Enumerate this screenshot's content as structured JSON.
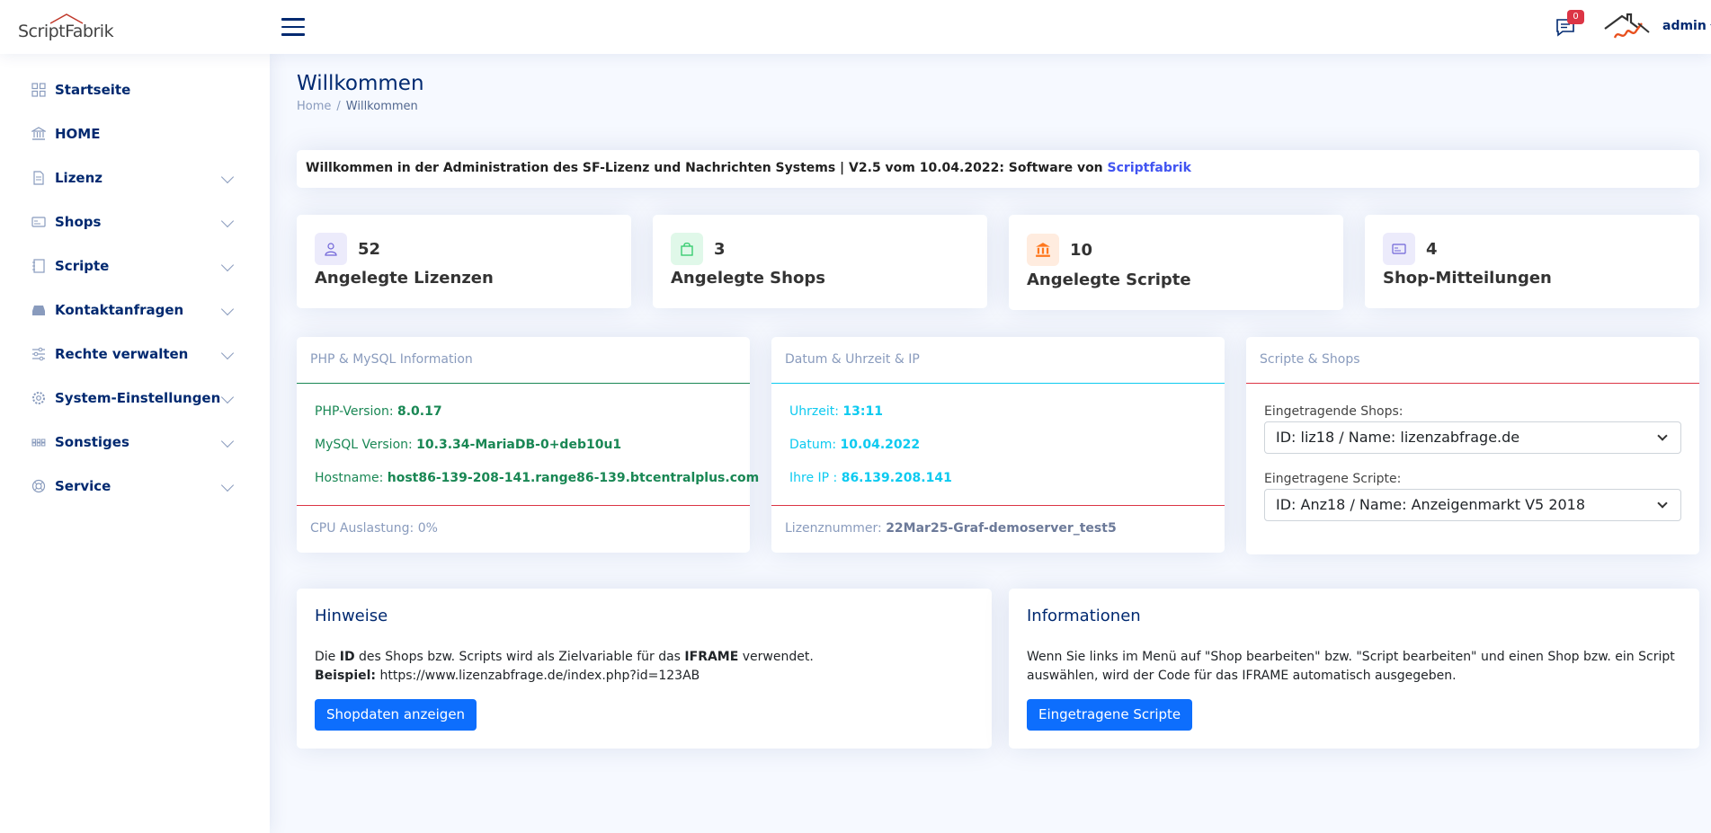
{
  "header": {
    "logo_text": "ScriptFabrik",
    "messages_count": "0",
    "user_name": "admin"
  },
  "sidebar": {
    "items": [
      {
        "label": "Startseite",
        "icon": "grid-icon",
        "has_children": false
      },
      {
        "label": "HOME",
        "icon": "bank-icon",
        "has_children": false
      },
      {
        "label": "Lizenz",
        "icon": "file-icon",
        "has_children": true
      },
      {
        "label": "Shops",
        "icon": "card-icon",
        "has_children": true
      },
      {
        "label": "Scripte",
        "icon": "journal-icon",
        "has_children": true
      },
      {
        "label": "Kontaktanfragen",
        "icon": "inbox-icon",
        "has_children": true
      },
      {
        "label": "Rechte verwalten",
        "icon": "sliders-icon",
        "has_children": true
      },
      {
        "label": "System-Einstellungen",
        "icon": "gear-icon",
        "has_children": true
      },
      {
        "label": "Sonstiges",
        "icon": "dots-icon",
        "has_children": true
      },
      {
        "label": "Service",
        "icon": "lifebuoy-icon",
        "has_children": true
      }
    ]
  },
  "page": {
    "title": "Willkommen",
    "breadcrumb_home": "Home",
    "breadcrumb_sep": "/",
    "breadcrumb_current": "Willkommen"
  },
  "welcome": {
    "text": "Willkommen in der Administration des SF-Lizenz und Nachrichten Systems | V2.5 vom 10.04.2022: Software von ",
    "link": "Scriptfabrik"
  },
  "stats": [
    {
      "count": "52",
      "label": "Angelegte Lizenzen",
      "icon": "person-icon",
      "bg": "#ecebfb",
      "fg": "#6f64d8"
    },
    {
      "count": "3",
      "label": "Angelegte Shops",
      "icon": "bag-icon",
      "bg": "#e0f8e9",
      "fg": "#2eca6a"
    },
    {
      "count": "10",
      "label": "Angelegte Scripte",
      "icon": "bank-icon",
      "bg": "#ffecdf",
      "fg": "#ff771d"
    },
    {
      "count": "4",
      "label": "Shop-Mitteilungen",
      "icon": "card-icon",
      "bg": "#ecebfb",
      "fg": "#6f64d8"
    }
  ],
  "php_info": {
    "title": "PHP & MySQL Information",
    "php_label": "PHP-Version: ",
    "php_value": "8.0.17",
    "mysql_label": "MySQL Version: ",
    "mysql_value": "10.3.34-MariaDB-0+deb10u1",
    "host_label": "Hostname: ",
    "host_value": "host86-139-208-141.range86-139.btcentralplus.com",
    "cpu": "CPU Auslastung: 0%",
    "accent": "#198754"
  },
  "date_info": {
    "title": "Datum & Uhrzeit & IP",
    "time_label": "Uhrzeit: ",
    "time_value": "13:11",
    "date_label": "Datum: ",
    "date_value": "10.04.2022",
    "ip_label": "Ihre IP : ",
    "ip_value": "86.139.208.141",
    "license_label": "Lizenznummer: ",
    "license_value": "22Mar25-Graf-demoserver_test5",
    "accent": "#0dcaf0"
  },
  "scripts_shops": {
    "title": "Scripte & Shops",
    "shops_label": "Eingetragende Shops:",
    "shops_selected": "ID: liz18  /  Name: lizenzabfrage.de",
    "scripts_label": "Eingetragene Scripte:",
    "scripts_selected": "ID: Anz18 /   Name: Anzeigenmarkt V5 2018"
  },
  "hinweise": {
    "title": "Hinweise",
    "line1_a": "Die ",
    "line1_b": "ID",
    "line1_c": " des Shops bzw. Scripts wird als Zielvariable für das ",
    "line1_d": "IFRAME",
    "line1_e": " verwendet.",
    "line2_a": "Beispiel:",
    "line2_b": " https://www.lizenzabfrage.de/index.php?id=123AB",
    "button": "Shopdaten anzeigen"
  },
  "informationen": {
    "title": "Informationen",
    "text": "Wenn Sie links im Menü auf \"Shop bearbeiten\" bzw. \"Script bearbeiten\" und einen Shop bzw. ein Script auswählen, wird der Code für das IFRAME automatisch ausgegeben.",
    "button": "Eingetragene Scripte"
  }
}
